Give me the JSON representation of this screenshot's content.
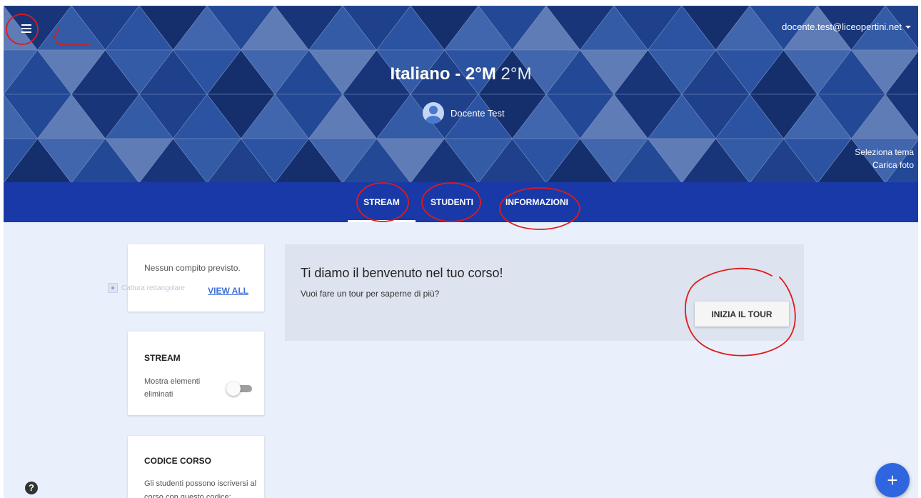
{
  "header": {
    "account_email": "docente.test@liceopertini.net",
    "class_name": "Italiano - 2°M",
    "class_section": "2°M",
    "teacher_name": "Docente Test",
    "select_theme": "Seleziona tema",
    "upload_photo": "Carica foto"
  },
  "tabs": [
    {
      "label": "STREAM",
      "active": true
    },
    {
      "label": "STUDENTI",
      "active": false
    },
    {
      "label": "INFORMAZIONI",
      "active": false
    }
  ],
  "sidebar": {
    "upcoming": {
      "empty_text": "Nessun compito previsto.",
      "view_all": "VIEW ALL"
    },
    "stream": {
      "title": "STREAM",
      "show_deleted_label": "Mostra elementi eliminati",
      "show_deleted_on": false
    },
    "class_code": {
      "title": "CODICE CORSO",
      "description": "Gli studenti possono iscriversi al corso con questo codice:"
    }
  },
  "capture_tooltip": "Cattura rettangolare",
  "welcome": {
    "title": "Ti diamo il benvenuto nel tuo corso!",
    "subtitle": "Vuoi fare un tour per saperne di più?",
    "tour_button": "INIZIA IL TOUR"
  },
  "help_symbol": "?",
  "fab_symbol": "+",
  "icons": [
    "menu-icon",
    "dropdown-caret-icon",
    "avatar-icon",
    "capture-icon",
    "help-icon",
    "add-icon"
  ],
  "colors": {
    "banner": "#1f3f8f",
    "tabbar": "#1a39a8",
    "page_bg": "#eaf0fb",
    "fab": "#2f66e0",
    "annotation": "#e01a1a"
  }
}
